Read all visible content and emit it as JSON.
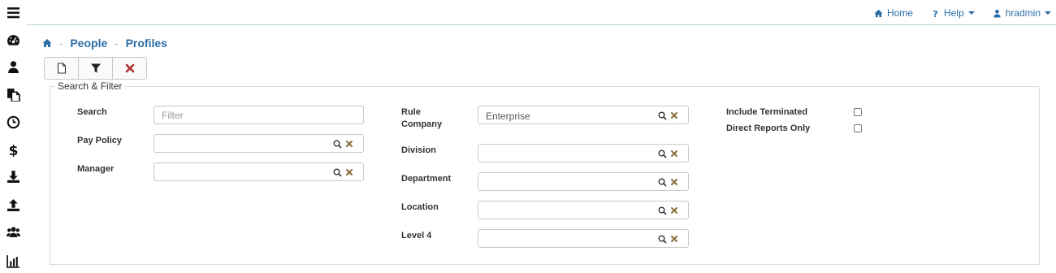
{
  "sidebar": {
    "icons": [
      "menu-icon",
      "dashboard-icon",
      "user-icon",
      "documents-icon",
      "clock-icon",
      "dollar-icon",
      "download-icon",
      "upload-icon",
      "users-icon",
      "chart-icon"
    ]
  },
  "topbar": {
    "home_label": "Home",
    "help_label": "Help",
    "user_label": "hradmin"
  },
  "breadcrumb": {
    "sep": "-",
    "people": "People",
    "profiles": "Profiles"
  },
  "panel": {
    "legend": "Search & Filter"
  },
  "form": {
    "search_label": "Search",
    "search_placeholder": "Filter",
    "pay_policy_label": "Pay Policy",
    "pay_policy_value": "",
    "manager_label": "Manager",
    "manager_value": "",
    "rule_company_label_1": "Rule",
    "rule_company_label_2": "Company",
    "rule_company_value": "Enterprise",
    "division_label": "Division",
    "division_value": "",
    "department_label": "Department",
    "department_value": "",
    "location_label": "Location",
    "location_value": "",
    "level4_label": "Level 4",
    "level4_value": "",
    "include_terminated_label": "Include Terminated",
    "include_terminated_checked": false,
    "direct_reports_label": "Direct Reports Only",
    "direct_reports_checked": false
  },
  "colors": {
    "link": "#2a6ea6",
    "clear_icon": "#8a6d3b",
    "delete_icon": "#b03030"
  }
}
